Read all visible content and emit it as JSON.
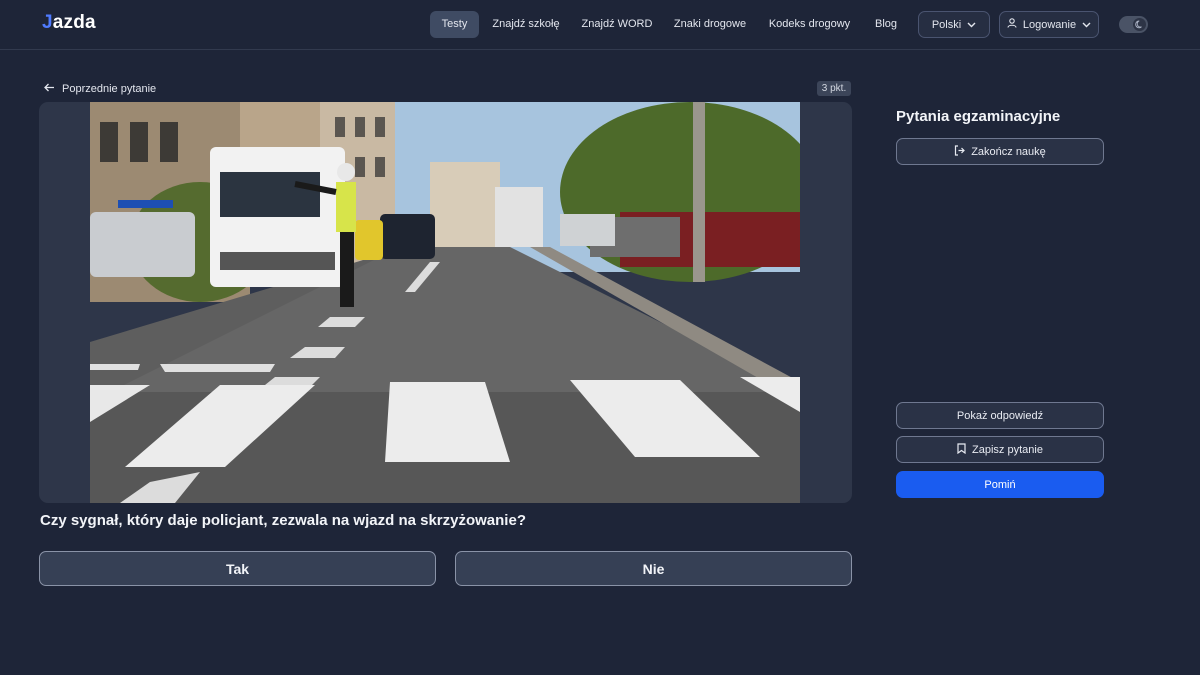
{
  "header": {
    "logo": "azda",
    "nav": [
      "Testy",
      "Znajdź szkołę",
      "Znajdź WORD",
      "Znaki drogowe",
      "Kodeks drogowy",
      "Blog"
    ],
    "language": "Polski",
    "login": "Logowanie"
  },
  "question": {
    "prev_label": "Poprzednie pytanie",
    "points": "3 pkt.",
    "text": "Czy sygnał, który daje policjant, zezwala na wjazd na skrzyżowanie?",
    "answers": [
      "Tak",
      "Nie"
    ]
  },
  "panel": {
    "title": "Pytania egzaminacyjne",
    "finish_label": "Zakończ naukę",
    "show_answer_label": "Pokaż odpowiedź",
    "save_label": "Zapisz pytanie",
    "skip_label": "Pomiń"
  },
  "colors": {
    "background": "#1e2538",
    "primary": "#1a5cf0",
    "logo_accent": "#4f7bff"
  }
}
